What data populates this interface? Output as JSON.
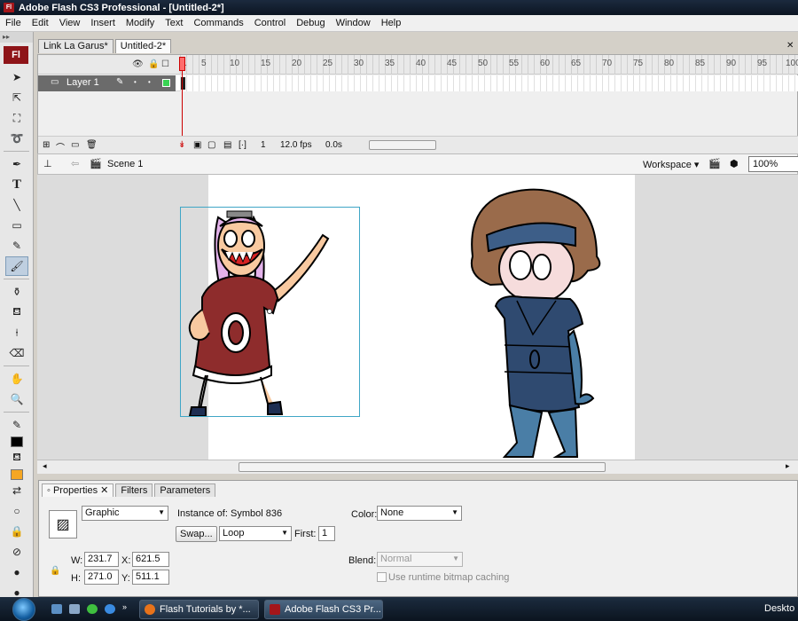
{
  "window": {
    "title": "Adobe Flash CS3 Professional - [Untitled-2*]",
    "app_icon": "Fl"
  },
  "menu": [
    "File",
    "Edit",
    "View",
    "Insert",
    "Modify",
    "Text",
    "Commands",
    "Control",
    "Debug",
    "Window",
    "Help"
  ],
  "toolbox": {
    "logo": "Fl",
    "tools": [
      "selection-icon",
      "subselection-icon",
      "free-transform-icon",
      "lasso-icon",
      "pen-icon",
      "text-icon",
      "line-icon",
      "rectangle-icon",
      "pencil-icon",
      "brush-icon",
      "ink-bottle-icon",
      "paint-bucket-icon",
      "eyedropper-icon",
      "eraser-icon",
      "hand-icon",
      "zoom-icon"
    ],
    "active_tool": "brush-icon",
    "stroke_color": "#000000",
    "fill_color": "#f5a623"
  },
  "document_tabs": [
    {
      "label": "Link La Garus*",
      "active": false
    },
    {
      "label": "Untitled-2*",
      "active": true
    }
  ],
  "timeline": {
    "frame_ticks": [
      "1",
      "5",
      "10",
      "15",
      "20",
      "25",
      "30",
      "35",
      "40",
      "45",
      "50",
      "55",
      "60",
      "65",
      "70",
      "75",
      "80",
      "85",
      "90",
      "95",
      "100"
    ],
    "layer_name": "Layer 1",
    "layer_color": "#39d353",
    "current_frame": "1",
    "frame_rate": "12.0 fps",
    "elapsed_time": "0.0s"
  },
  "edit_bar": {
    "scene": "Scene 1",
    "workspace": "Workspace",
    "zoom": "100%"
  },
  "properties": {
    "tabs": [
      "Properties",
      "Filters",
      "Parameters"
    ],
    "symbol_type": "Graphic",
    "instance_of_label": "Instance of:",
    "instance_of": "Symbol 836",
    "swap_button": "Swap...",
    "loop_mode": "Loop",
    "first_label": "First:",
    "first_frame": "1",
    "color_label": "Color:",
    "color_value": "None",
    "blend_label": "Blend:",
    "blend_value": "Normal",
    "bitmap_cache_label": "Use runtime bitmap caching",
    "w_label": "W:",
    "w": "231.7",
    "h_label": "H:",
    "h": "271.0",
    "x_label": "X:",
    "x": "621.5",
    "y_label": "Y:",
    "y": "511.1"
  },
  "taskbar": {
    "tasks": [
      {
        "label": "Flash Tutorials by *...",
        "active": false
      },
      {
        "label": "Adobe Flash CS3 Pr...",
        "active": true
      }
    ],
    "tray_text": "Deskto"
  }
}
